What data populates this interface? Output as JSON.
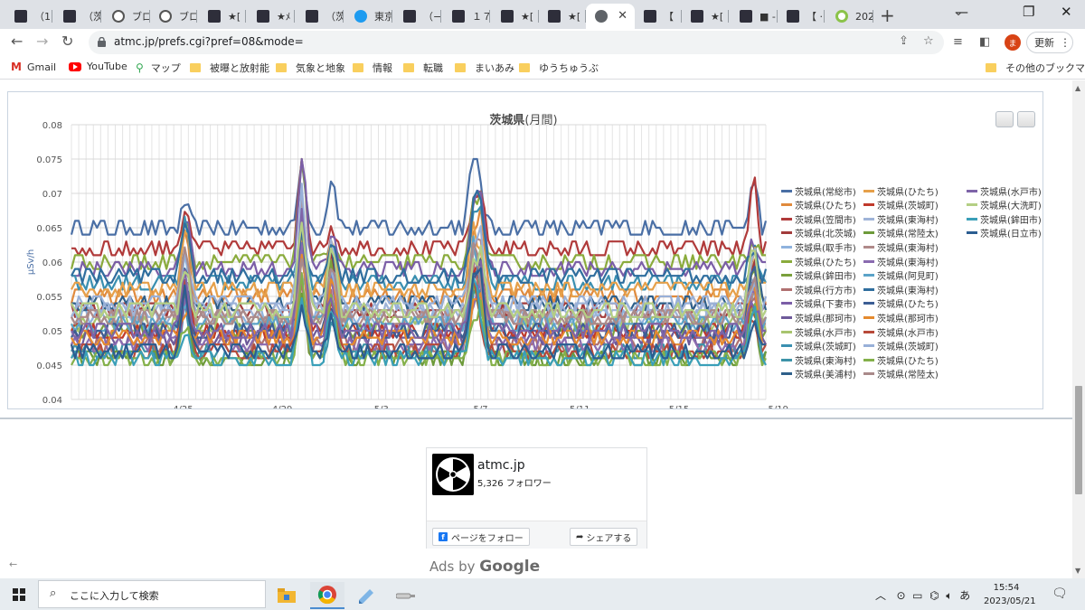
{
  "tabs": [
    {
      "title": "（1",
      "icon": "site-icon"
    },
    {
      "title": "（茨",
      "icon": "site-icon"
    },
    {
      "title": "ブロ",
      "icon": "info-circle-icon"
    },
    {
      "title": "ブロ",
      "icon": "info-circle-icon"
    },
    {
      "title": "★[",
      "icon": "site-icon"
    },
    {
      "title": "★ﾒ",
      "icon": "site-icon"
    },
    {
      "title": "（茨",
      "icon": "site-icon"
    },
    {
      "title": "東京",
      "icon": "twitter-bird-icon"
    },
    {
      "title": "（−",
      "icon": "site-icon"
    },
    {
      "title": "１７",
      "icon": "site-icon"
    },
    {
      "title": "★[",
      "icon": "site-icon"
    },
    {
      "title": "★[",
      "icon": "site-icon"
    },
    {
      "title": "",
      "icon": "globe-icon",
      "active": true
    },
    {
      "title": "【",
      "icon": "site-icon"
    },
    {
      "title": "★[",
      "icon": "site-icon"
    },
    {
      "title": "■ -",
      "icon": "site-icon"
    },
    {
      "title": "【 ·",
      "icon": "site-icon"
    },
    {
      "title": "202",
      "icon": "green-ring-icon"
    }
  ],
  "browser": {
    "url": "atmc.jp/prefs.cgi?pref=08&mode=",
    "update_label": "更新",
    "profile_initial": "ま"
  },
  "bookmarks": [
    {
      "label": "Gmail",
      "icon": "gmail-icon"
    },
    {
      "label": "YouTube",
      "icon": "youtube-icon"
    },
    {
      "label": "マップ",
      "icon": "maps-pin-icon"
    },
    {
      "label": "被曝と放射能",
      "icon": "folder-icon"
    },
    {
      "label": "気象と地象",
      "icon": "folder-icon"
    },
    {
      "label": "情報",
      "icon": "folder-icon"
    },
    {
      "label": "転職",
      "icon": "folder-icon"
    },
    {
      "label": "まいあみ",
      "icon": "folder-icon"
    },
    {
      "label": "ゆうちゅうぶ",
      "icon": "folder-icon"
    }
  ],
  "other_bookmarks": "その他のブックマーク",
  "chart_data": {
    "type": "line",
    "title": "茨城県",
    "title_suffix": "(月間)",
    "ylabel": "μSv/h",
    "ylim": [
      0.04,
      0.08
    ],
    "yticks": [
      "0.04",
      "0.045",
      "0.05",
      "0.055",
      "0.06",
      "0.065",
      "0.07",
      "0.075",
      "0.08"
    ],
    "xlim": [
      0,
      28
    ],
    "xticks": [
      {
        "label": "4/25",
        "x": 4.5
      },
      {
        "label": "4/29",
        "x": 8.5
      },
      {
        "label": "5/3",
        "x": 12.5
      },
      {
        "label": "5/7",
        "x": 16.5
      },
      {
        "label": "5/11",
        "x": 20.5
      },
      {
        "label": "5/15",
        "x": 24.5
      },
      {
        "label": "5/19",
        "x": 28.5
      }
    ],
    "spike_days": [
      4.6,
      9.3,
      10.5,
      16.2,
      16.5,
      27.5
    ],
    "series": [
      {
        "name": "茨城県(常総市)",
        "color": "#4a6fa5",
        "base": 0.065
      },
      {
        "name": "茨城県(ひたち)",
        "color": "#e08a3c",
        "base": 0.055
      },
      {
        "name": "茨城県(笠間市)",
        "color": "#b03a3a",
        "base": 0.062
      },
      {
        "name": "茨城県(北茨城)",
        "color": "#a23b3b",
        "base": 0.053
      },
      {
        "name": "茨城県(取手市)",
        "color": "#8fb3de",
        "base": 0.052
      },
      {
        "name": "茨城県(ひたち)",
        "color": "#8aab3c",
        "base": 0.06
      },
      {
        "name": "茨城県(鉾田市)",
        "color": "#7aa03c",
        "base": 0.05
      },
      {
        "name": "茨城県(行方市)",
        "color": "#b07070",
        "base": 0.048
      },
      {
        "name": "茨城県(下妻市)",
        "color": "#7b5ea7",
        "base": 0.059
      },
      {
        "name": "茨城県(那珂市)",
        "color": "#6e5a9a",
        "base": 0.049
      },
      {
        "name": "茨城県(水戸市)",
        "color": "#a8c46e",
        "base": 0.051
      },
      {
        "name": "茨城県(茨城町)",
        "color": "#3a8fb0",
        "base": 0.057
      },
      {
        "name": "茨城県(東海村)",
        "color": "#3d93a8",
        "base": 0.047
      },
      {
        "name": "茨城県(美浦村)",
        "color": "#2e5f8a",
        "base": 0.054
      },
      {
        "name": "茨城県(ひたち)",
        "color": "#e6a04a",
        "base": 0.056
      },
      {
        "name": "茨城県(茨城町)",
        "color": "#c0392b",
        "base": 0.05
      },
      {
        "name": "茨城県(東海村)",
        "color": "#9fb4d8",
        "base": 0.053
      },
      {
        "name": "茨城県(常陸太)",
        "color": "#6d9a3a",
        "base": 0.046
      },
      {
        "name": "茨城県(東海村)",
        "color": "#b08a8a",
        "base": 0.052
      },
      {
        "name": "茨城県(東海村)",
        "color": "#8a6bb0",
        "base": 0.048
      },
      {
        "name": "茨城県(阿見町)",
        "color": "#5ba3c8",
        "base": 0.051
      },
      {
        "name": "茨城県(東海村)",
        "color": "#2f6e9e",
        "base": 0.058
      },
      {
        "name": "茨城県(ひたち)",
        "color": "#3c5e94",
        "base": 0.05
      },
      {
        "name": "茨城県(那珂市)",
        "color": "#e58a2e",
        "base": 0.049
      },
      {
        "name": "茨城県(水戸市)",
        "color": "#b84a3a",
        "base": 0.047
      },
      {
        "name": "茨城県(茨城町)",
        "color": "#98b0d8",
        "base": 0.054
      },
      {
        "name": "茨城県(ひたち)",
        "color": "#84b04a",
        "base": 0.046
      },
      {
        "name": "茨城県(常陸太)",
        "color": "#a98a8a",
        "base": 0.052
      },
      {
        "name": "茨城県(水戸市)",
        "color": "#7e64a8",
        "base": 0.05
      },
      {
        "name": "茨城県(大洗町)",
        "color": "#b4cf84",
        "base": 0.053
      },
      {
        "name": "茨城県(鉾田市)",
        "color": "#3a9fb8",
        "base": 0.046
      },
      {
        "name": "茨城県(日立市)",
        "color": "#2b5d91",
        "base": 0.047
      }
    ]
  },
  "facebook": {
    "name": "atmc.jp",
    "followers": "5,326 フォロワー",
    "follow_label": "ページをフォロー",
    "share_label": "シェアする"
  },
  "ads": {
    "prefix": "Ads by ",
    "brand": "Google"
  },
  "taskbar": {
    "search_placeholder": "ここに入力して検索",
    "time": "15:54",
    "date": "2023/05/21",
    "ime": "あ"
  }
}
